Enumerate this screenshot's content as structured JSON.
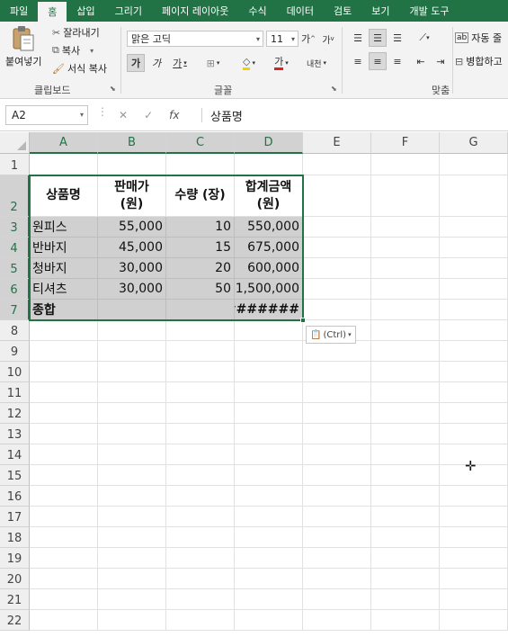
{
  "ribbon_tabs": [
    "파일",
    "홈",
    "삽입",
    "그리기",
    "페이지 레이아웃",
    "수식",
    "데이터",
    "검토",
    "보기",
    "개발 도구"
  ],
  "clipboard": {
    "paste": "붙여넣기",
    "cut": "잘라내기",
    "copy": "복사",
    "format_painter": "서식 복사",
    "group_label": "클립보드"
  },
  "font": {
    "name": "맑은 고딕",
    "size": "11",
    "grow": "가",
    "shrink": "가",
    "bold": "가",
    "italic": "가",
    "underline": "가",
    "color_label": "가",
    "phonetic": "내천",
    "group_label": "글꼴"
  },
  "alignment": {
    "wrap_text": "자동 줄",
    "merge": "병합하고",
    "group_label": "맞춤"
  },
  "formula_bar": {
    "name_box": "A2",
    "fx": "fx",
    "content": "상품명"
  },
  "columns": [
    "A",
    "B",
    "C",
    "D",
    "E",
    "F",
    "G"
  ],
  "rows": [
    "1",
    "2",
    "3",
    "4",
    "5",
    "6",
    "7",
    "8",
    "9",
    "10",
    "11",
    "12",
    "13",
    "14",
    "15",
    "16",
    "17",
    "18",
    "19",
    "20",
    "21",
    "22"
  ],
  "table": {
    "headers": [
      "상품명",
      "판매가\n(원)",
      "수량 (장)",
      "합계금액\n(원)"
    ],
    "rows": [
      [
        "원피스",
        "55,000",
        "10",
        "550,000"
      ],
      [
        "반바지",
        "45,000",
        "15",
        "675,000"
      ],
      [
        "청바지",
        "30,000",
        "20",
        "600,000"
      ],
      [
        "티셔츠",
        "30,000",
        "50",
        "1,500,000"
      ],
      [
        "종합",
        "",
        "",
        "#######"
      ]
    ]
  },
  "paste_options": "(Ctrl)"
}
